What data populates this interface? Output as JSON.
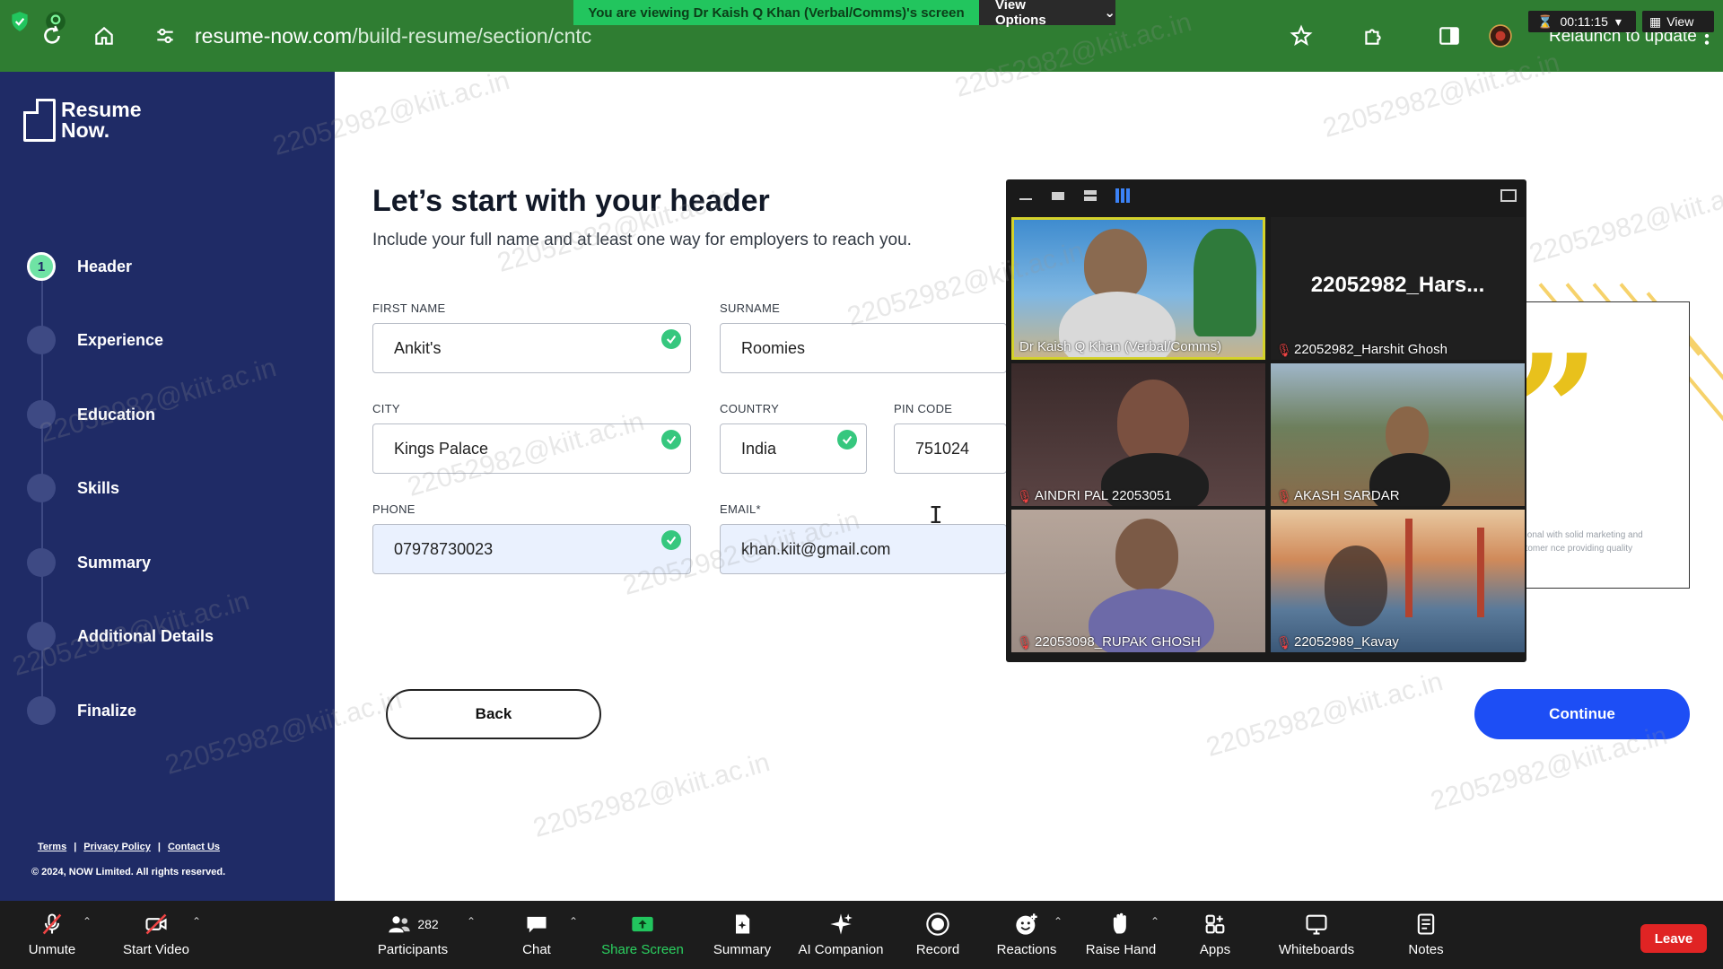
{
  "browser": {
    "url_host": "resume-now.com",
    "url_path": "/build-resume/section/cntc",
    "relaunch_text": "Relaunch to update"
  },
  "zoom_top": {
    "viewing_text": "You are viewing Dr Kaish Q Khan (Verbal/Comms)'s screen",
    "view_options_label": "View Options",
    "timer": "00:11:15",
    "view_label": "View"
  },
  "sidebar": {
    "logo_line1": "Resume",
    "logo_line2": "Now.",
    "steps": [
      {
        "number": "1",
        "label": "Header",
        "active": true
      },
      {
        "number": "",
        "label": "Experience",
        "active": false
      },
      {
        "number": "",
        "label": "Education",
        "active": false
      },
      {
        "number": "",
        "label": "Skills",
        "active": false
      },
      {
        "number": "",
        "label": "Summary",
        "active": false
      },
      {
        "number": "",
        "label": "Additional Details",
        "active": false
      },
      {
        "number": "",
        "label": "Finalize",
        "active": false
      }
    ],
    "footer_links": [
      "Terms",
      "Privacy Policy",
      "Contact Us"
    ],
    "copyright": "© 2024, NOW Limited. All rights reserved."
  },
  "form": {
    "heading": "Let’s start with your header",
    "subheading": "Include your full name and at least one way for employers to reach you.",
    "first_name": {
      "label": "FIRST NAME",
      "value": "Ankit's"
    },
    "surname": {
      "label": "SURNAME",
      "value": "Roomies"
    },
    "city": {
      "label": "CITY",
      "value": "Kings Palace"
    },
    "country": {
      "label": "COUNTRY",
      "value": "India"
    },
    "pin_code": {
      "label": "PIN CODE",
      "value": "751024"
    },
    "phone": {
      "label": "PHONE",
      "value": "07978730023"
    },
    "email": {
      "label": "EMAIL*",
      "value": "khan.kiit@gmail.com"
    },
    "back_label": "Back",
    "continue_label": "Continue"
  },
  "preview": {
    "text": "essional with solid marketing and customer nce providing quality"
  },
  "gallery": {
    "tiles": [
      {
        "name": "Dr Kaish Q Khan (Verbal/Comms)",
        "muted": false,
        "speaking": true
      },
      {
        "name": "22052982_Harshit Ghosh",
        "big_name": "22052982_Hars...",
        "muted": true
      },
      {
        "name": "AINDRI PAL 22053051",
        "muted": true
      },
      {
        "name": "AKASH SARDAR",
        "muted": true
      },
      {
        "name": "22053098_RUPAK GHOSH",
        "muted": true
      },
      {
        "name": "22052989_Kavay",
        "muted": true
      }
    ]
  },
  "zoom_bar": {
    "unmute": "Unmute",
    "start_video": "Start Video",
    "participants": "Participants",
    "participants_count": "282",
    "chat": "Chat",
    "share_screen": "Share Screen",
    "summary": "Summary",
    "ai_companion": "AI Companion",
    "record": "Record",
    "reactions": "Reactions",
    "raise_hand": "Raise Hand",
    "apps": "Apps",
    "whiteboards": "Whiteboards",
    "notes": "Notes",
    "leave": "Leave"
  },
  "watermark": "22052982@kiit.ac.in",
  "colors": {
    "sidebar": "#1f2b66",
    "accent_blue": "#1d4ef5",
    "check_green": "#36c77e",
    "browser_green": "#2f7d32",
    "zoom_green": "#22c55e",
    "leave_red": "#e02424"
  }
}
